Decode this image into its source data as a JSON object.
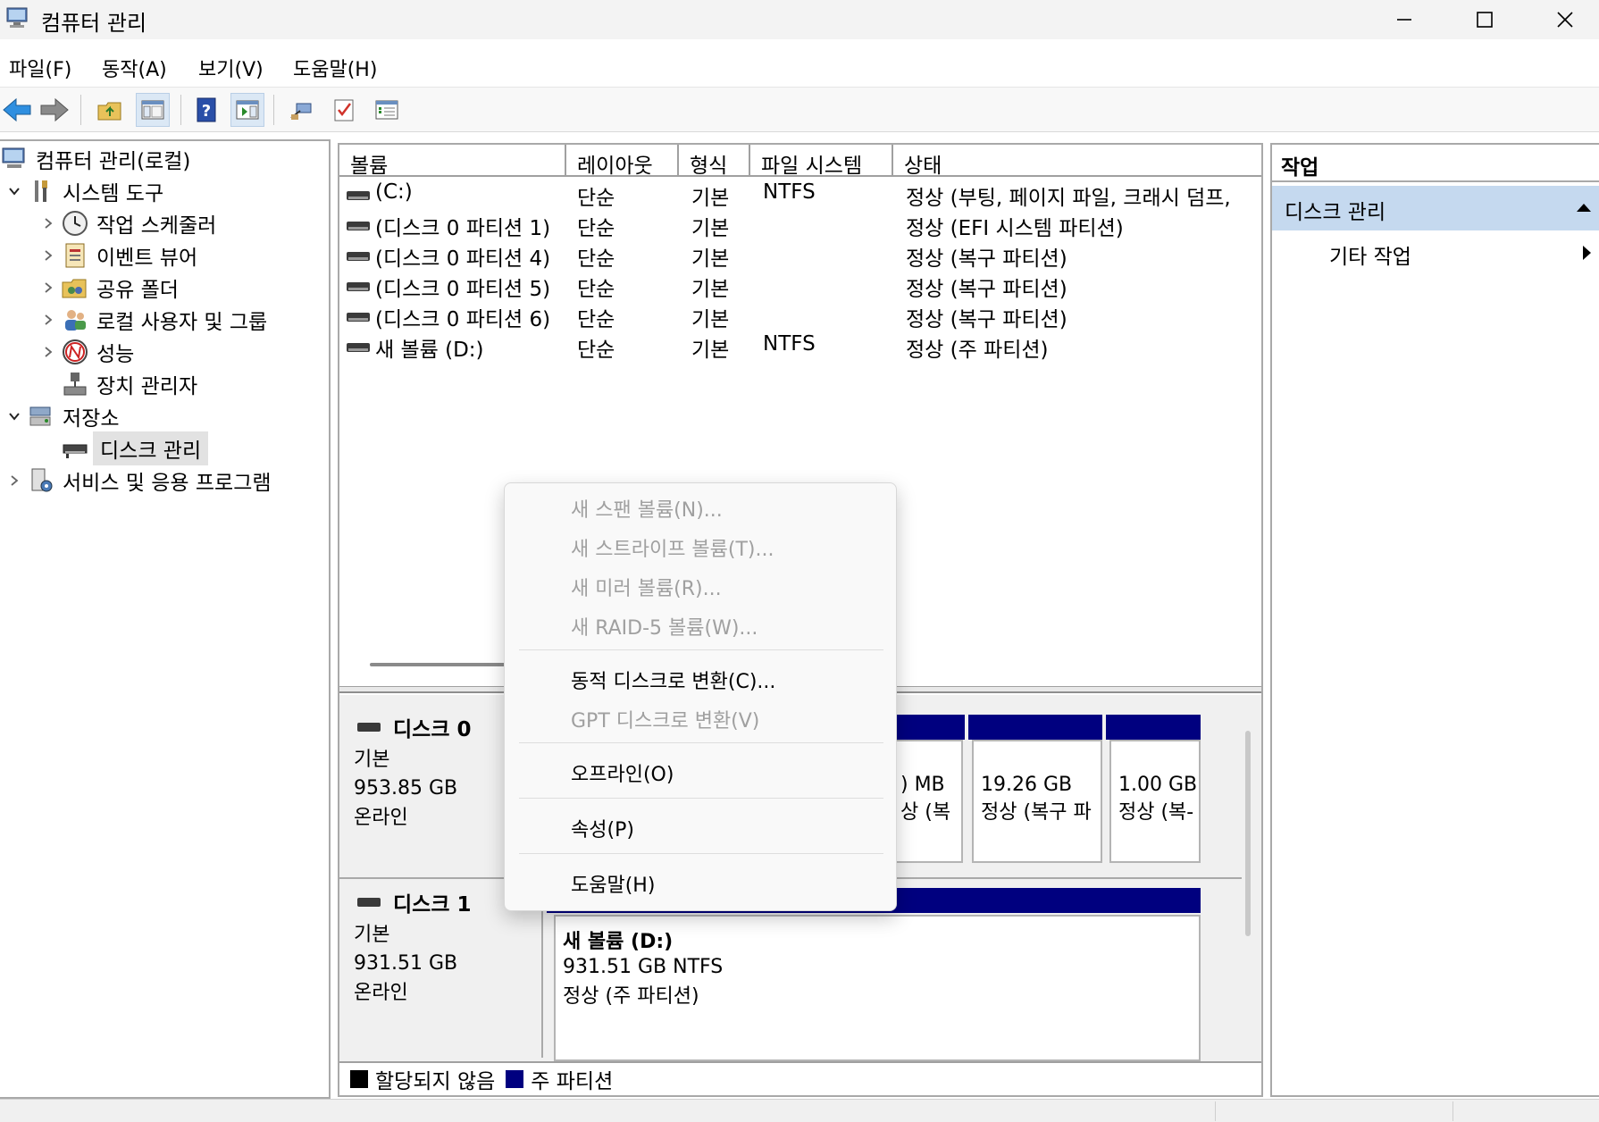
{
  "window": {
    "title": "컴퓨터 관리",
    "controls": [
      "minimize",
      "maximize",
      "close"
    ]
  },
  "menu": [
    "파일(F)",
    "동작(A)",
    "보기(V)",
    "도움말(H)"
  ],
  "toolbar_icons": [
    "back-arrow-icon",
    "forward-arrow-icon",
    "up-folder-icon",
    "show-hide-tree-icon",
    "help-icon",
    "action-pane-icon",
    "connect-icon",
    "check-icon",
    "properties-list-icon"
  ],
  "tree": {
    "root": "컴퓨터 관리(로컬)",
    "items": [
      {
        "label": "시스템 도구",
        "level": 1,
        "expanded": true
      },
      {
        "label": "작업 스케줄러",
        "level": 2,
        "expanded": false
      },
      {
        "label": "이벤트 뷰어",
        "level": 2,
        "expanded": false
      },
      {
        "label": "공유 폴더",
        "level": 2,
        "expanded": false
      },
      {
        "label": "로컬 사용자 및 그룹",
        "level": 2,
        "expanded": false
      },
      {
        "label": "성능",
        "level": 2,
        "expanded": false
      },
      {
        "label": "장치 관리자",
        "level": 2,
        "expanded": null
      },
      {
        "label": "저장소",
        "level": 1,
        "expanded": true
      },
      {
        "label": "디스크 관리",
        "level": 2,
        "expanded": null,
        "selected": true
      },
      {
        "label": "서비스 및 응용 프로그램",
        "level": 1,
        "expanded": false
      }
    ]
  },
  "volumes": {
    "columns": [
      "볼륨",
      "레이아웃",
      "형식",
      "파일 시스템",
      "상태"
    ],
    "rows": [
      {
        "volume": " (C:)",
        "layout": "단순",
        "type": "기본",
        "fs": "NTFS",
        "status": "정상 (부팅, 페이지 파일, 크래시 덤프,"
      },
      {
        "volume": "(디스크 0 파티션 1)",
        "layout": "단순",
        "type": "기본",
        "fs": "",
        "status": "정상 (EFI 시스템 파티션)"
      },
      {
        "volume": "(디스크 0 파티션 4)",
        "layout": "단순",
        "type": "기본",
        "fs": "",
        "status": "정상 (복구 파티션)"
      },
      {
        "volume": "(디스크 0 파티션 5)",
        "layout": "단순",
        "type": "기본",
        "fs": "",
        "status": "정상 (복구 파티션)"
      },
      {
        "volume": "(디스크 0 파티션 6)",
        "layout": "단순",
        "type": "기본",
        "fs": "",
        "status": "정상 (복구 파티션)"
      },
      {
        "volume": "새 볼륨 (D:)",
        "layout": "단순",
        "type": "기본",
        "fs": "NTFS",
        "status": "정상 (주 파티션)"
      }
    ]
  },
  "disks": [
    {
      "name": "디스크 0",
      "type": "기본",
      "size": "953.85 GB",
      "state": "온라인",
      "partitions": [
        {
          "line1": ") MB",
          "line2": "상 (복"
        },
        {
          "line1": "19.26 GB",
          "line2": "정상 (복구 파"
        },
        {
          "line1": "1.00 GB",
          "line2": "정상 (복-"
        }
      ]
    },
    {
      "name": "디스크 1",
      "type": "기본",
      "size": "931.51 GB",
      "state": "온라인",
      "partitions": [
        {
          "title": "새 볼륨  (D:)",
          "line1": "931.51 GB NTFS",
          "line2": "정상 (주 파티션)"
        }
      ]
    }
  ],
  "legend": [
    {
      "label": "할당되지 않음",
      "color": "#000000"
    },
    {
      "label": "주 파티션",
      "color": "#00007f"
    }
  ],
  "actions": {
    "header": "작업",
    "section": "디스크 관리",
    "item": "기타 작업"
  },
  "context_menu": {
    "items": [
      {
        "label": "새 스팬 볼륨(N)...",
        "enabled": false
      },
      {
        "label": "새 스트라이프 볼륨(T)...",
        "enabled": false
      },
      {
        "label": "새 미러 볼륨(R)...",
        "enabled": false
      },
      {
        "label": "새 RAID-5 볼륨(W)...",
        "enabled": false
      },
      {
        "label": "동적 디스크로 변환(C)...",
        "enabled": true
      },
      {
        "label": "GPT 디스크로 변환(V)",
        "enabled": false
      },
      {
        "label": "오프라인(O)",
        "enabled": true
      },
      {
        "label": "속성(P)",
        "enabled": true
      },
      {
        "label": "도움말(H)",
        "enabled": true
      }
    ]
  },
  "colors": {
    "primary_partition": "#00007f",
    "action_section": "#c5d9ef"
  }
}
